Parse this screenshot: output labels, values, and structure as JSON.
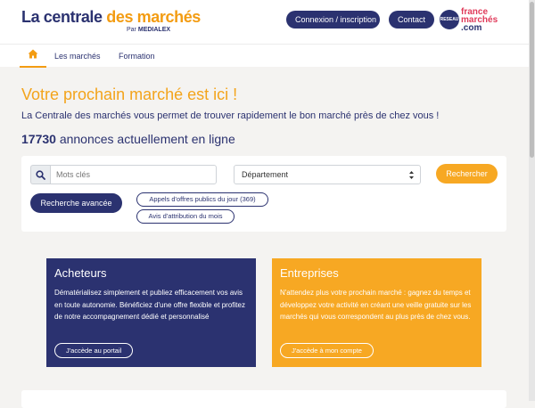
{
  "header": {
    "logo_part1": "La centrale ",
    "logo_part2": "des marchés",
    "logo_sub_prefix": "Par",
    "logo_sub_brand": "MEDIALEX",
    "login_label": "Connexion / inscription",
    "contact_label": "Contact",
    "partner_badge": "RESEAU",
    "partner_line1": "france",
    "partner_line2": "marchés",
    "partner_line3": ".com"
  },
  "nav": {
    "home_icon": "home-icon",
    "items": [
      {
        "label": "Les marchés"
      },
      {
        "label": "Formation"
      }
    ]
  },
  "hero": {
    "title": "Votre prochain marché est ici !",
    "subtitle": "La Centrale des marchés vous permet de trouver rapidement le bon marché près de chez vous !",
    "count": "17730",
    "count_suffix": " annonces actuellement en ligne"
  },
  "search": {
    "icon": "search-icon",
    "keywords_placeholder": "Mots clés",
    "department_selected": "Département",
    "submit_label": "Rechercher",
    "advanced_label": "Recherche avancée",
    "tender_link": "Appels d'offres publics du jour (369)",
    "award_link": "Avis d'attribution du mois"
  },
  "panels": {
    "buyers": {
      "title": "Acheteurs",
      "text": "Dématérialisez simplement et publiez efficacement vos avis en toute autonomie. Bénéficiez d'une offre flexible et profitez de notre accompagnement dédié et personnalisé",
      "button": "J'accède au portail"
    },
    "companies": {
      "title": "Entreprises",
      "text": "N'attendez plus votre prochain marché : gagnez du temps et développez votre activité en créant une veille gratuite sur les marchés qui vous correspondent au plus près de chez vous.",
      "button": "J'accède à mon compte"
    }
  },
  "colors": {
    "navy": "#2b3270",
    "orange": "#f7a823",
    "background": "#f4f3f1",
    "partner_red": "#e03a5a"
  }
}
